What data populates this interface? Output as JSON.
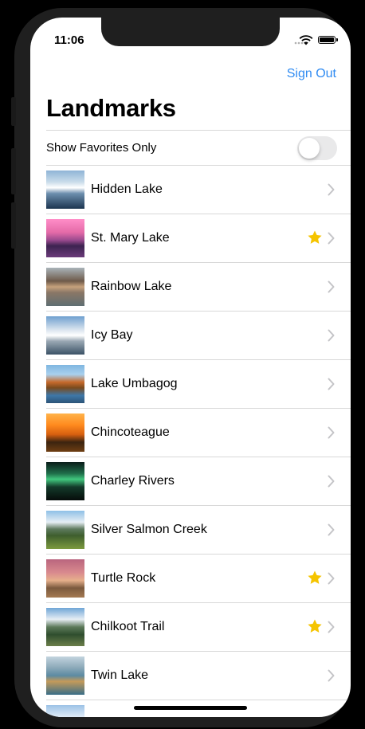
{
  "status_bar": {
    "time": "11:06",
    "icons": [
      "cellular-signal-icon",
      "wifi-icon",
      "battery-icon"
    ]
  },
  "nav": {
    "sign_out_label": "Sign Out",
    "title": "Landmarks"
  },
  "filter": {
    "label": "Show Favorites Only",
    "enabled": false
  },
  "colors": {
    "accent": "#2f8bf2",
    "star": "#f5c400",
    "chevron": "#c4c4c7",
    "separator": "#d8d8d8"
  },
  "landmarks": [
    {
      "name": "Hidden Lake",
      "favorite": false,
      "image_icon": "mountain-lake-snow-image"
    },
    {
      "name": "St. Mary Lake",
      "favorite": true,
      "image_icon": "pink-sunset-mountain-image"
    },
    {
      "name": "Rainbow Lake",
      "favorite": false,
      "image_icon": "mountain-reflection-lake-image"
    },
    {
      "name": "Icy Bay",
      "favorite": false,
      "image_icon": "snowy-mountains-bay-image"
    },
    {
      "name": "Lake Umbagog",
      "favorite": false,
      "image_icon": "autumn-lake-image"
    },
    {
      "name": "Chincoteague",
      "favorite": false,
      "image_icon": "orange-sunset-marsh-image"
    },
    {
      "name": "Charley Rivers",
      "favorite": false,
      "image_icon": "aurora-forest-image"
    },
    {
      "name": "Silver Salmon Creek",
      "favorite": false,
      "image_icon": "green-meadow-mountain-image"
    },
    {
      "name": "Turtle Rock",
      "favorite": true,
      "image_icon": "joshua-tree-desert-image"
    },
    {
      "name": "Chilkoot Trail",
      "favorite": true,
      "image_icon": "alpine-trail-image"
    },
    {
      "name": "Twin Lake",
      "favorite": false,
      "image_icon": "canoe-lake-image"
    },
    {
      "name": "",
      "favorite": false,
      "image_icon": "snowy-peak-image"
    }
  ]
}
